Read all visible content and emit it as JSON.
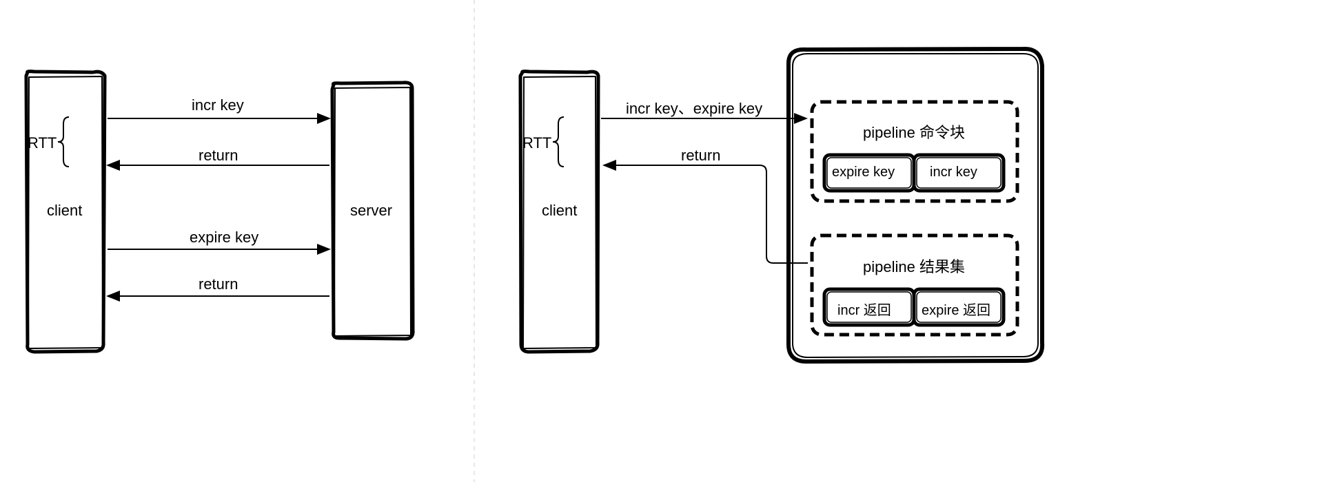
{
  "left": {
    "client": "client",
    "server": "server",
    "rtt": "RTT",
    "arrows": {
      "incr": "incr key",
      "return1": "return",
      "expire": "expire key",
      "return2": "return"
    }
  },
  "right": {
    "client": "client",
    "rtt": "RTT",
    "arrows": {
      "send": "incr key、expire key",
      "return": "return"
    },
    "cmdBlock": {
      "title": "pipeline 命令块",
      "item1": "expire key",
      "item2": "incr key"
    },
    "resultBlock": {
      "title": "pipeline 结果集",
      "item1": "incr 返回",
      "item2": "expire 返回"
    }
  }
}
